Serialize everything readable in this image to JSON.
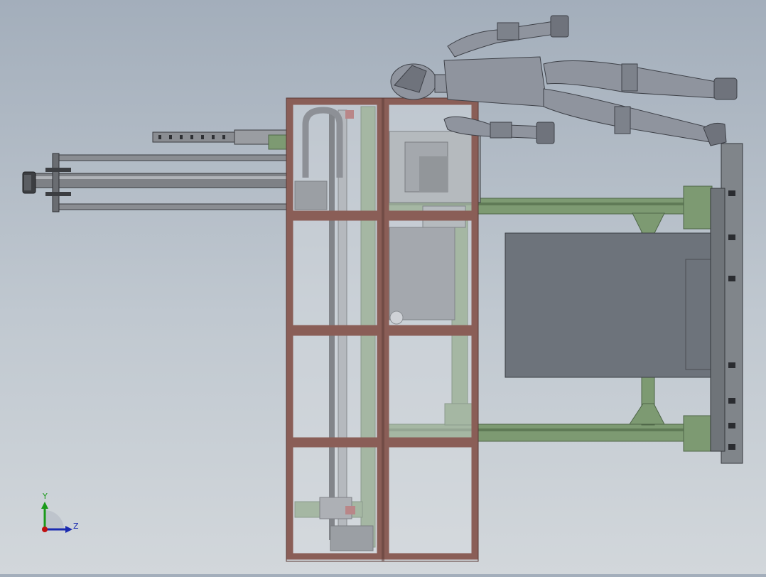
{
  "viewport": {
    "background_top": "#a3aebb",
    "background_bottom": "#d2d7db"
  },
  "triad": {
    "y_label": "Y",
    "z_label": "Z",
    "y_color": "#1a9a1a",
    "z_color": "#1a2ab0",
    "origin_color": "#c01010"
  },
  "colors": {
    "frame": "#8a5e57",
    "frame_dark": "#5a3a35",
    "steel": "#7d9a72",
    "steel_dark": "#4e6648",
    "rod": "#8a8d92",
    "mannequin": "#8f949e",
    "panel": "#6d737b",
    "plate": "#80858a"
  }
}
